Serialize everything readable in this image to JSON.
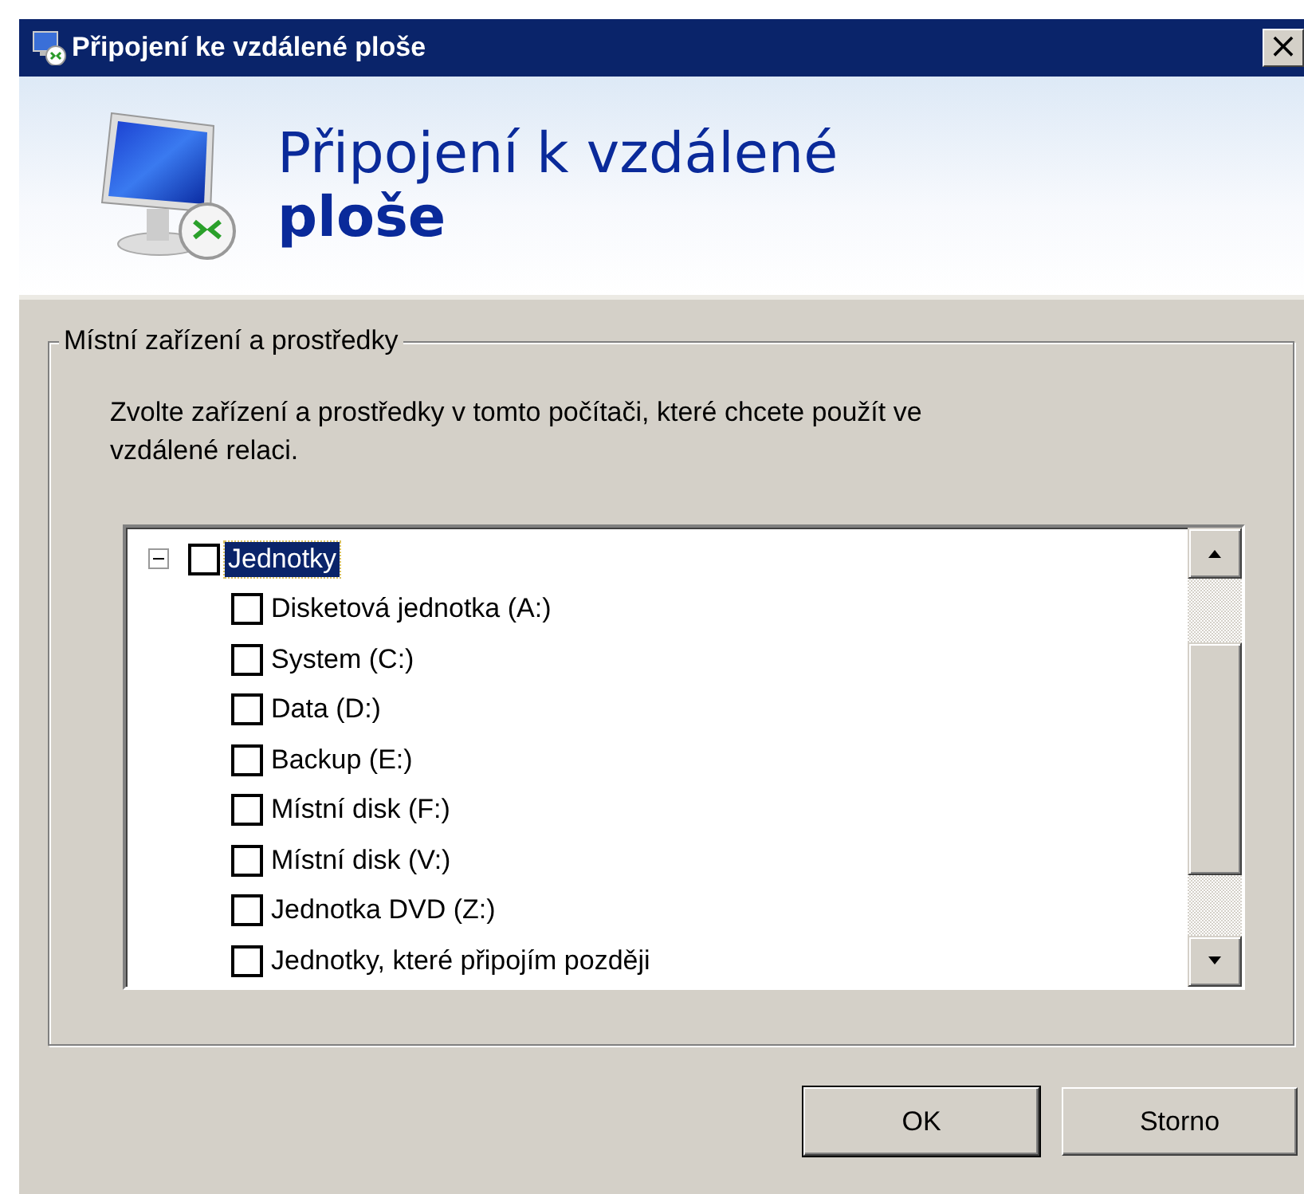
{
  "window": {
    "title": "Připojení ke vzdálené ploše",
    "close": "×"
  },
  "header": {
    "title_line_1": "Připojení k vzdálené",
    "title_line_2": "ploše"
  },
  "group": {
    "label": "Místní zařízení a prostředky",
    "description": "Zvolte zařízení a prostředky v tomto počítači, které chcete použít ve vzdálené relaci.",
    "tree": [
      {
        "label": "Jednotky",
        "checked": false,
        "selected": true,
        "expanded": true,
        "children": [
          {
            "label": "Disketová jednotka (A:)",
            "checked": false,
            "selected": false
          },
          {
            "label": "System (C:)",
            "checked": false,
            "selected": false
          },
          {
            "label": "Data (D:)",
            "checked": false,
            "selected": false
          },
          {
            "label": "Backup (E:)",
            "checked": false,
            "selected": false
          },
          {
            "label": "Místní disk (F:)",
            "checked": false,
            "selected": false
          },
          {
            "label": "Místní disk (V:)",
            "checked": false,
            "selected": false
          },
          {
            "label": "Jednotka DVD (Z:)",
            "checked": false,
            "selected": false
          },
          {
            "label": "Jednotky, které připojím později",
            "checked": false,
            "selected": false
          }
        ]
      }
    ]
  },
  "buttons": [
    {
      "label": "OK",
      "default": true
    },
    {
      "label": "Storno",
      "default": false
    }
  ]
}
